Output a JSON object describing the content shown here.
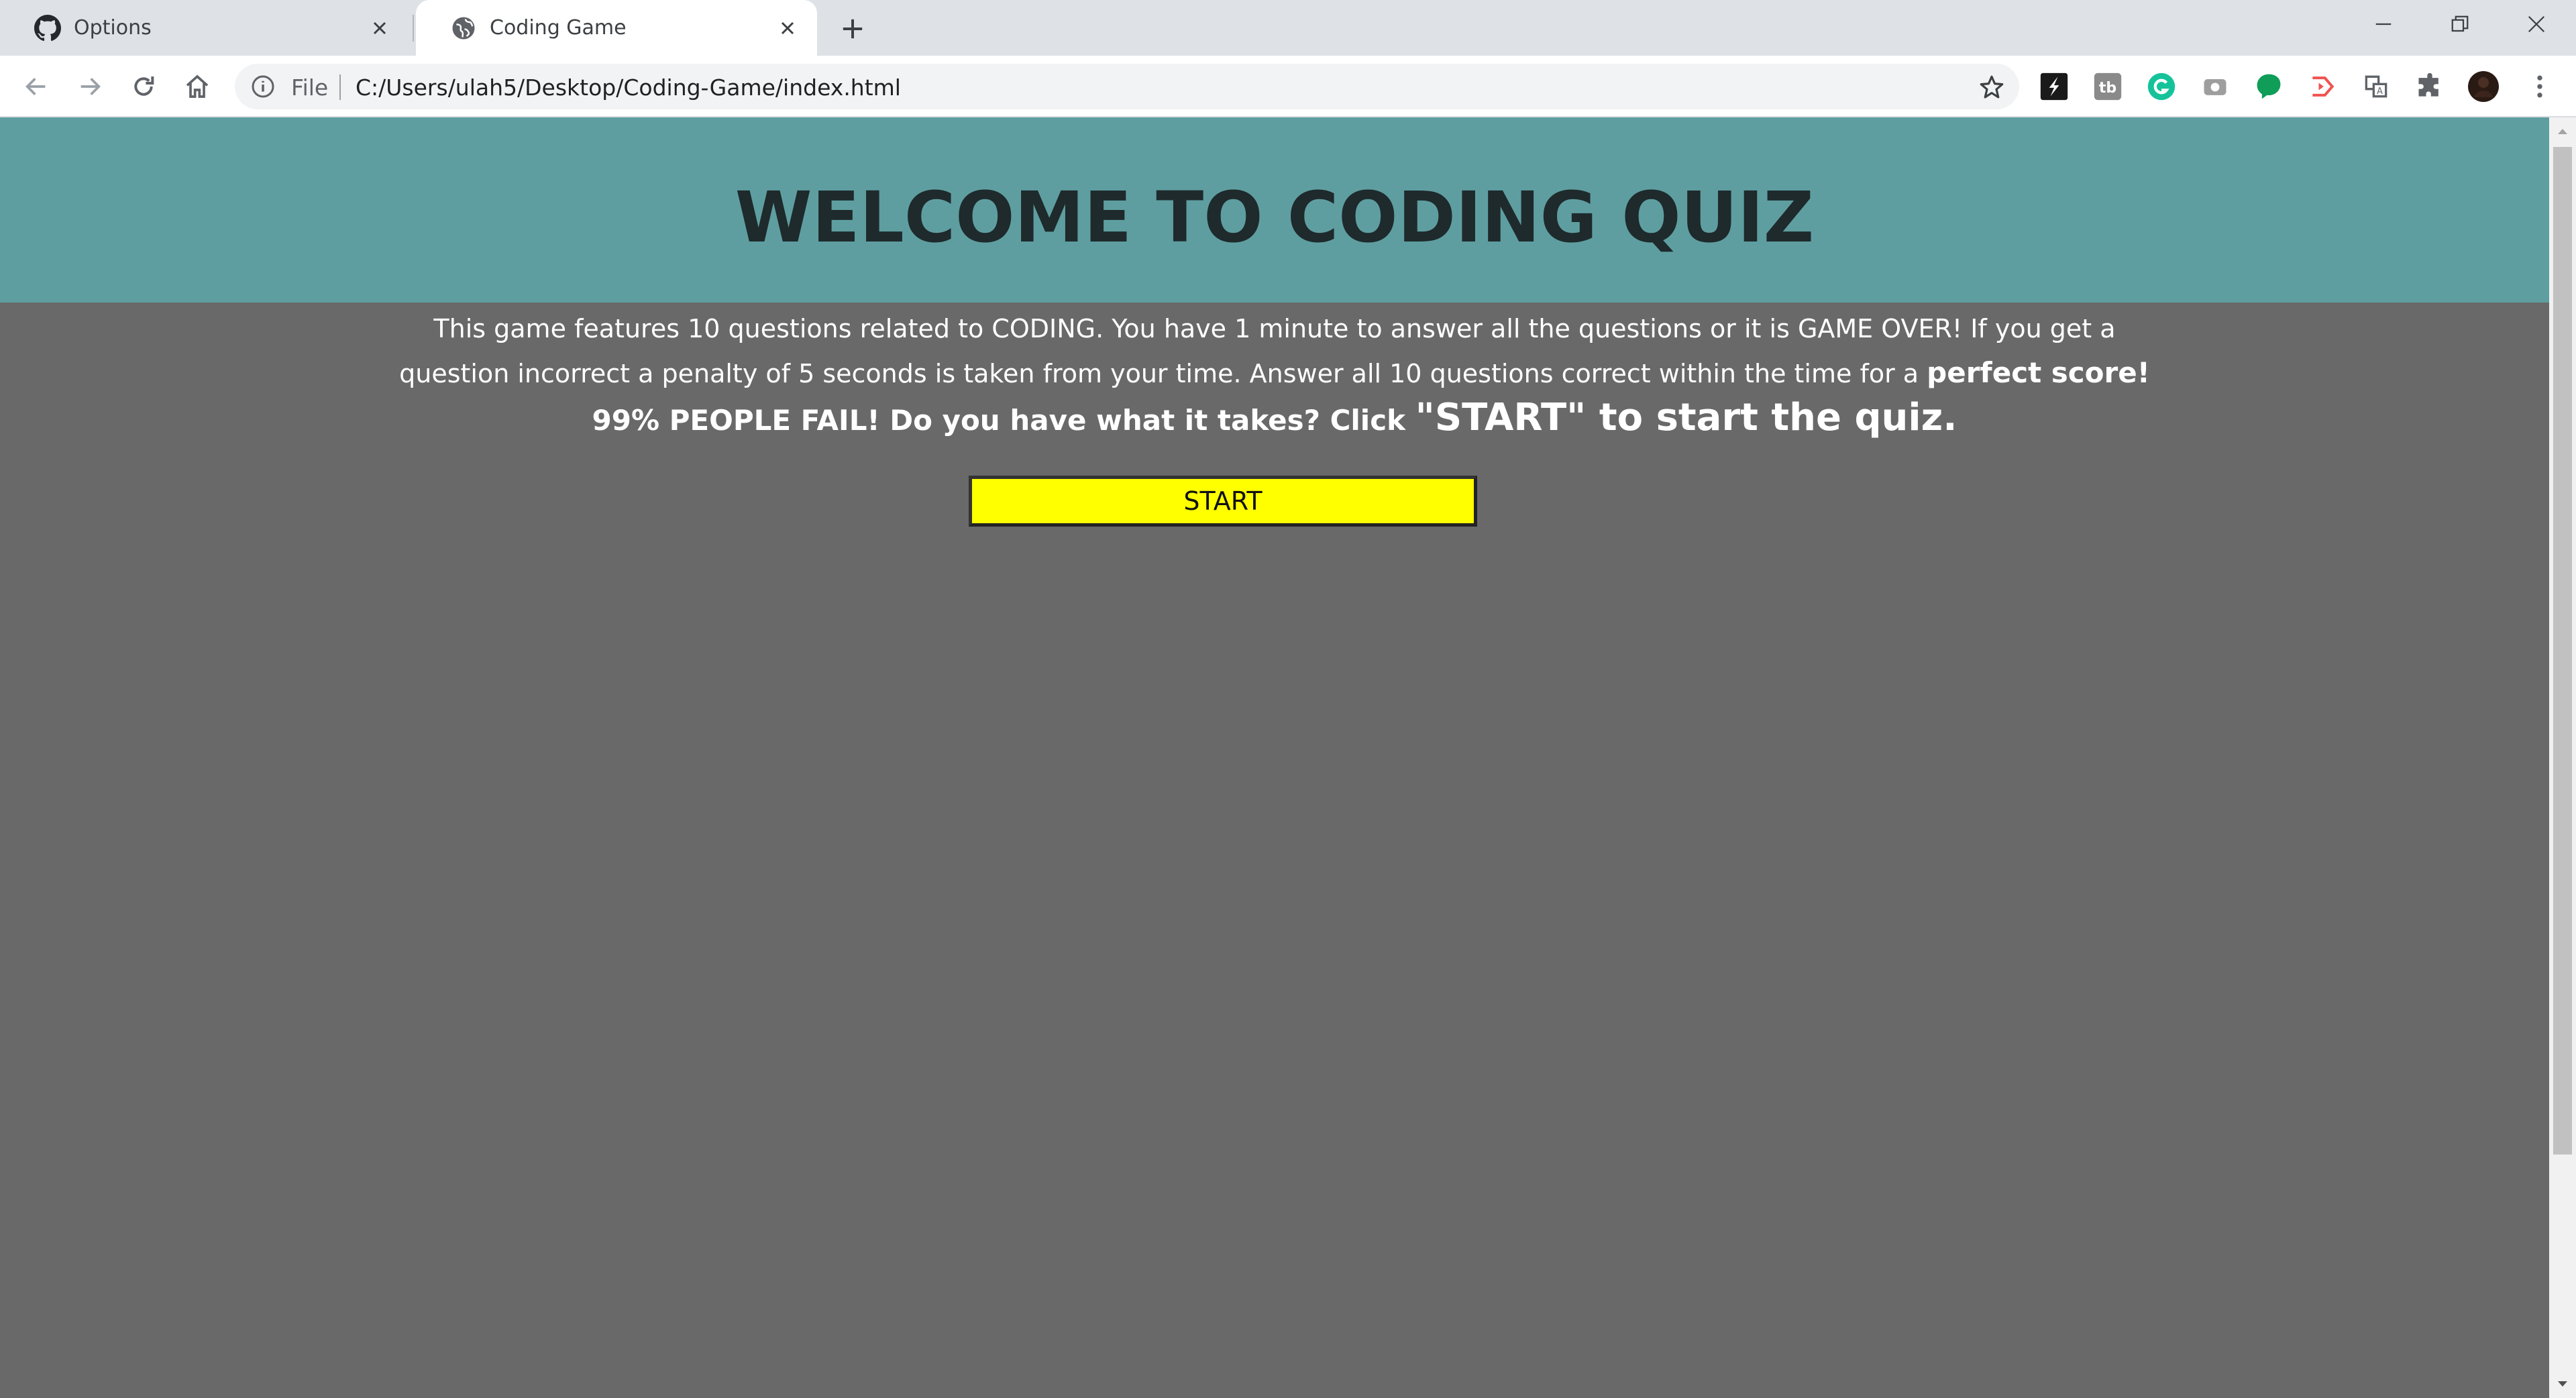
{
  "browser": {
    "tabs": [
      {
        "title": "Options",
        "icon": "github-icon"
      },
      {
        "title": "Coding Game",
        "icon": "globe-icon",
        "active": true
      }
    ],
    "address": {
      "scheme_label": "File",
      "url": "C:/Users/ulah5/Desktop/Coding-Game/index.html"
    },
    "extensions": [
      "sparkle-icon",
      "tb-icon",
      "grammarly-icon",
      "camera-icon",
      "chat-bubble-icon",
      "cast-icon",
      "translate-icon",
      "puzzle-icon",
      "avatar"
    ]
  },
  "page": {
    "heading": "WELCOME TO CODING QUIZ",
    "intro": {
      "plain": "This game features 10 questions related to CODING. You have 1 minute to answer all the questions or it is GAME OVER! If you get a question incorrect a penalty of 5 seconds is taken from your time. Answer all 10 questions correct within the time for a ",
      "bold_1": "perfect score! 99% PEOPLE FAIL! Do you ",
      "bold_2": "have what it takes? Click ",
      "bold_3": "\"START\" to start the quiz."
    },
    "start_button": "START"
  },
  "colors": {
    "header_bg": "#5f9ea0",
    "page_bg": "#696969",
    "button_bg": "#ffff00"
  }
}
